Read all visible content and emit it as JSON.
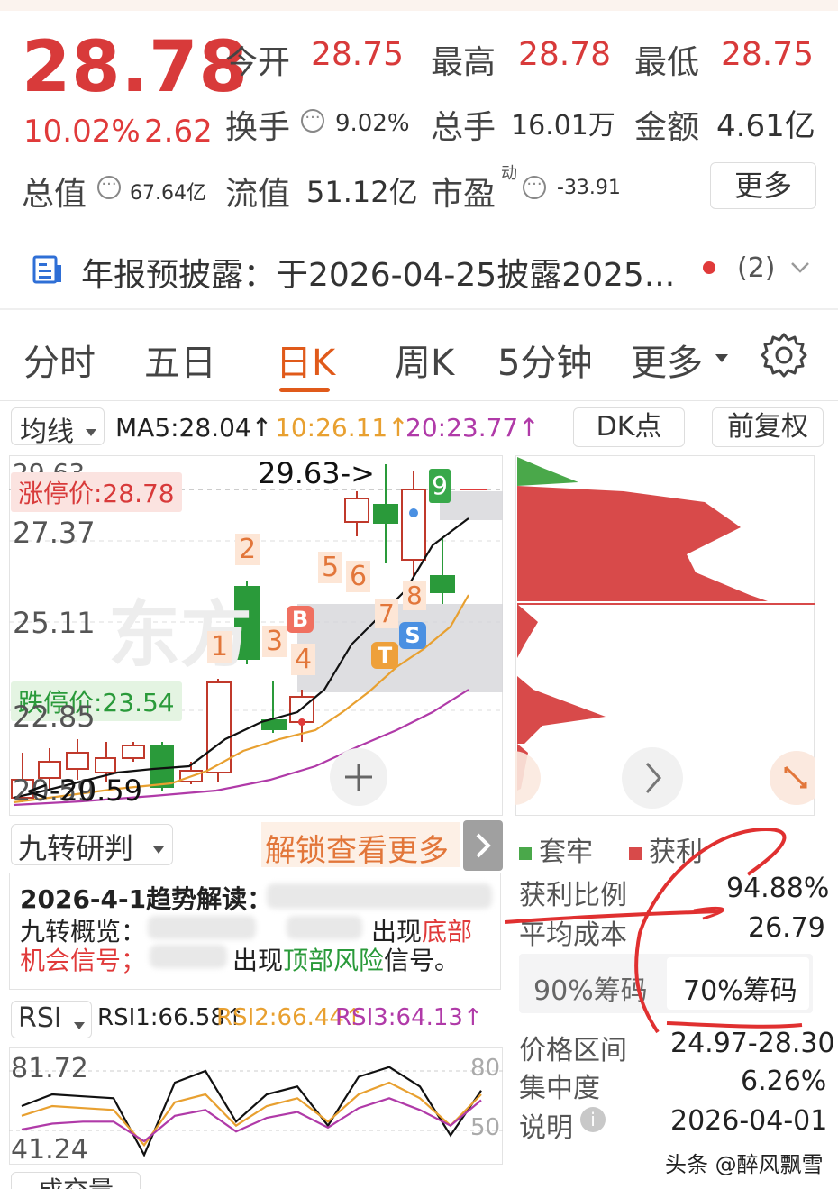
{
  "quote": {
    "price": "28.78",
    "change_pct": "10.02%",
    "change_amt": "2.62",
    "open_label": "今开",
    "open_val": "28.75",
    "high_label": "最高",
    "high_val": "28.78",
    "low_label": "最低",
    "low_val": "28.75",
    "turnover_label": "换手",
    "turnover_val": "9.02%",
    "volume_label": "总手",
    "volume_val": "16.01万",
    "amount_label": "金额",
    "amount_val": "4.61亿",
    "mktcap_label": "总值",
    "mktcap_val": "67.64亿",
    "float_label": "流值",
    "float_val": "51.12亿",
    "pe_label": "市盈",
    "pe_sup": "动",
    "pe_val": "-33.91",
    "more_button": "更多"
  },
  "notice": {
    "text": "年报预披露：于2026-04-25披露2025...",
    "count": "(2)"
  },
  "tabs": [
    "分时",
    "五日",
    "日K",
    "周K",
    "5分钟",
    "更多"
  ],
  "active_tab": "日K",
  "ma_bar": {
    "selector": "均线",
    "ma5": "MA5:28.04↑",
    "ma10": "10:26.11↑",
    "ma20": "20:23.77↑",
    "dk_button": "DK点",
    "adj_button": "前复权"
  },
  "kline": {
    "y_top": "29.63",
    "y_2737": "27.37",
    "y_2511": "25.11",
    "y_2285": "22.85",
    "y_2059": "20.59",
    "limit_up": "涨停价:28.78",
    "limit_down": "跌停价:23.54",
    "max_marker": "29.63->",
    "min_marker": "<-20.59",
    "nine_turn_badge": "9",
    "seq_labels": [
      "1",
      "2",
      "3",
      "4",
      "5",
      "6",
      "7",
      "8"
    ],
    "tags": {
      "b": "B",
      "t": "T",
      "s": "S"
    },
    "watermark": "东方"
  },
  "chip_panel": {
    "legend_trapped": "套牢",
    "legend_profit": "获利",
    "profit_ratio_label": "获利比例",
    "profit_ratio_val": "94.88%",
    "avg_cost_label": "平均成本",
    "avg_cost_val": "26.79",
    "tab_90": "90%筹码",
    "tab_70": "70%筹码",
    "range_label": "价格区间",
    "range_val": "24.97-28.30",
    "concentration_label": "集中度",
    "concentration_val": "6.26%",
    "desc_label": "说明",
    "desc_val": "2026-04-01"
  },
  "nine_turn": {
    "selector": "九转研判",
    "unlock": "解锁查看更多",
    "trend_title": "2026-4-1趋势解读：",
    "overview_label": "九转概览：",
    "appear1": "出现",
    "bottom": "底部",
    "opportunity": "机会信号；",
    "appear2": "出现",
    "top_risk": "顶部风险",
    "signal": "信号。"
  },
  "rsi": {
    "selector": "RSI",
    "rsi1": "RSI1:66.58↑",
    "rsi2": "RSI2:66.44↑",
    "rsi3": "RSI3:64.13↑",
    "y_high": "81.72",
    "y_low": "41.24",
    "ref_80": "80",
    "ref_50": "50",
    "rsi1_values": [
      60,
      66,
      65,
      64,
      35,
      72,
      78,
      52,
      66,
      70,
      50,
      75,
      80,
      70,
      45,
      68
    ],
    "rsi2_values": [
      55,
      60,
      59,
      58,
      40,
      62,
      66,
      50,
      60,
      64,
      52,
      66,
      72,
      64,
      50,
      66
    ],
    "rsi3_values": [
      48,
      51,
      52,
      52,
      42,
      55,
      58,
      47,
      54,
      57,
      49,
      59,
      64,
      58,
      50,
      63
    ]
  },
  "volume_bar": {
    "selector": "成交量"
  },
  "watermark": "头条 @醉风飘雪",
  "colors": {
    "rise": "#d83a3a",
    "fall": "#2a9a3a",
    "ma5": "#111111",
    "ma10": "#e8a030",
    "ma20": "#b03aa8",
    "accent_tab": "#e05a1a"
  }
}
